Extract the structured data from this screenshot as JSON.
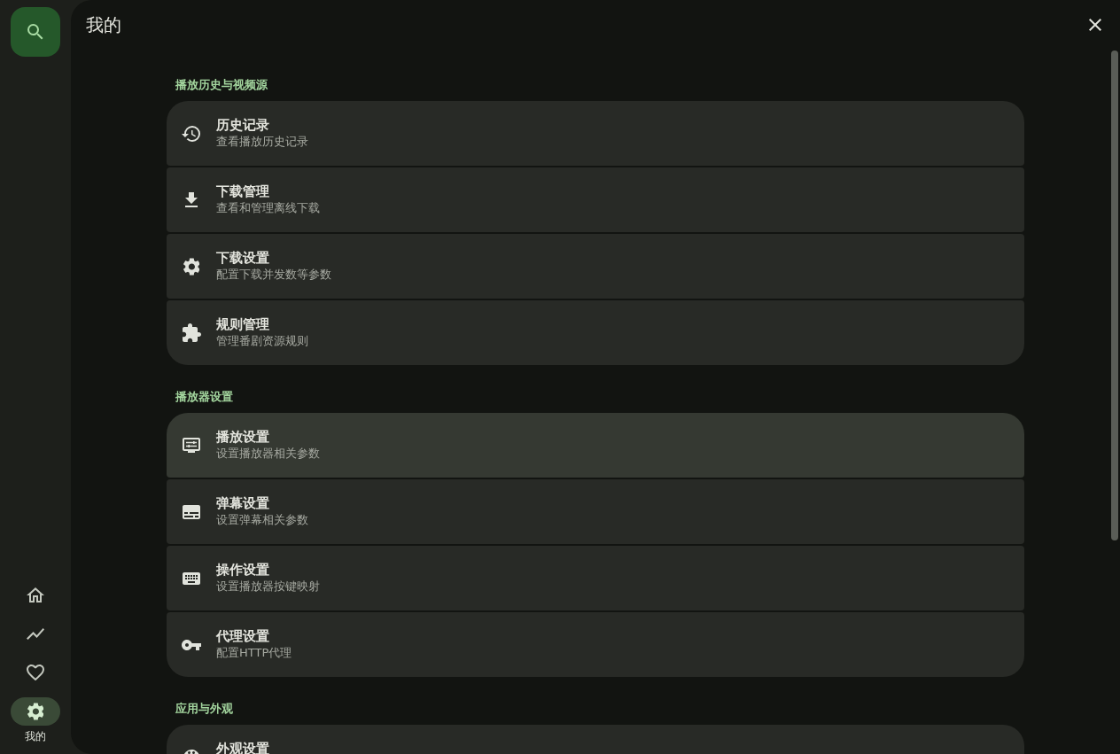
{
  "sidebar": {
    "nav_items": [
      {
        "selected": false
      },
      {
        "selected": false
      },
      {
        "selected": false
      },
      {
        "label": "我的",
        "selected": true
      }
    ]
  },
  "header": {
    "title": "我的"
  },
  "sections": [
    {
      "title": "播放历史与视频源",
      "items": [
        {
          "title": "历史记录",
          "subtitle": "查看播放历史记录",
          "highlighted": false
        },
        {
          "title": "下载管理",
          "subtitle": "查看和管理离线下载",
          "highlighted": false
        },
        {
          "title": "下载设置",
          "subtitle": "配置下载并发数等参数",
          "highlighted": false
        },
        {
          "title": "规则管理",
          "subtitle": "管理番剧资源规则",
          "highlighted": false
        }
      ]
    },
    {
      "title": "播放器设置",
      "items": [
        {
          "title": "播放设置",
          "subtitle": "设置播放器相关参数",
          "highlighted": true
        },
        {
          "title": "弹幕设置",
          "subtitle": "设置弹幕相关参数",
          "highlighted": false
        },
        {
          "title": "操作设置",
          "subtitle": "设置播放器按键映射",
          "highlighted": false
        },
        {
          "title": "代理设置",
          "subtitle": "配置HTTP代理",
          "highlighted": false
        }
      ]
    },
    {
      "title": "应用与外观",
      "items": [
        {
          "title": "外观设置",
          "highlighted": false
        }
      ]
    }
  ]
}
